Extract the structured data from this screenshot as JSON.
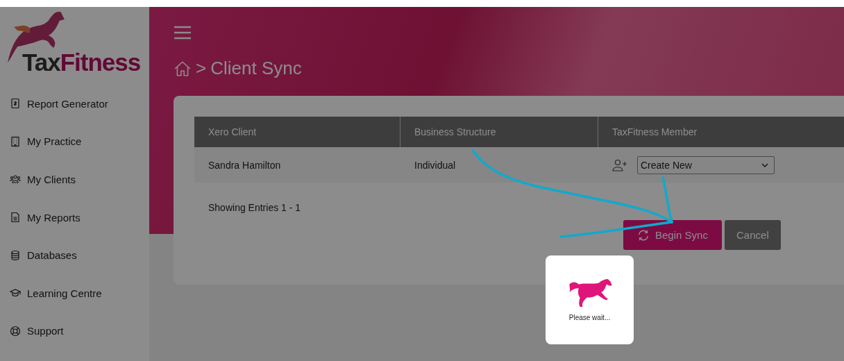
{
  "logo": {
    "dark": "Tax",
    "accent": "Fitness"
  },
  "sidebar": {
    "items": [
      {
        "label": "Report Generator",
        "kind": "report"
      },
      {
        "label": "My Practice",
        "kind": "building"
      },
      {
        "label": "My Clients",
        "kind": "people"
      },
      {
        "label": "My Reports",
        "kind": "document"
      },
      {
        "label": "Databases",
        "kind": "database"
      },
      {
        "label": "Learning Centre",
        "kind": "cap"
      },
      {
        "label": "Support",
        "kind": "lifebuoy"
      }
    ]
  },
  "breadcrumb": {
    "separator": ">",
    "current": "Client Sync"
  },
  "table": {
    "columns": [
      "Xero Client",
      "Business Structure",
      "TaxFitness Member"
    ],
    "rows": [
      {
        "client": "Sandra Hamilton",
        "structure": "Individual",
        "member": "Create New"
      }
    ]
  },
  "entries": "Showing Entries 1 - 1",
  "buttons": {
    "primary": "Begin Sync",
    "secondary": "Cancel"
  },
  "loader": {
    "text": "Please wait..."
  }
}
